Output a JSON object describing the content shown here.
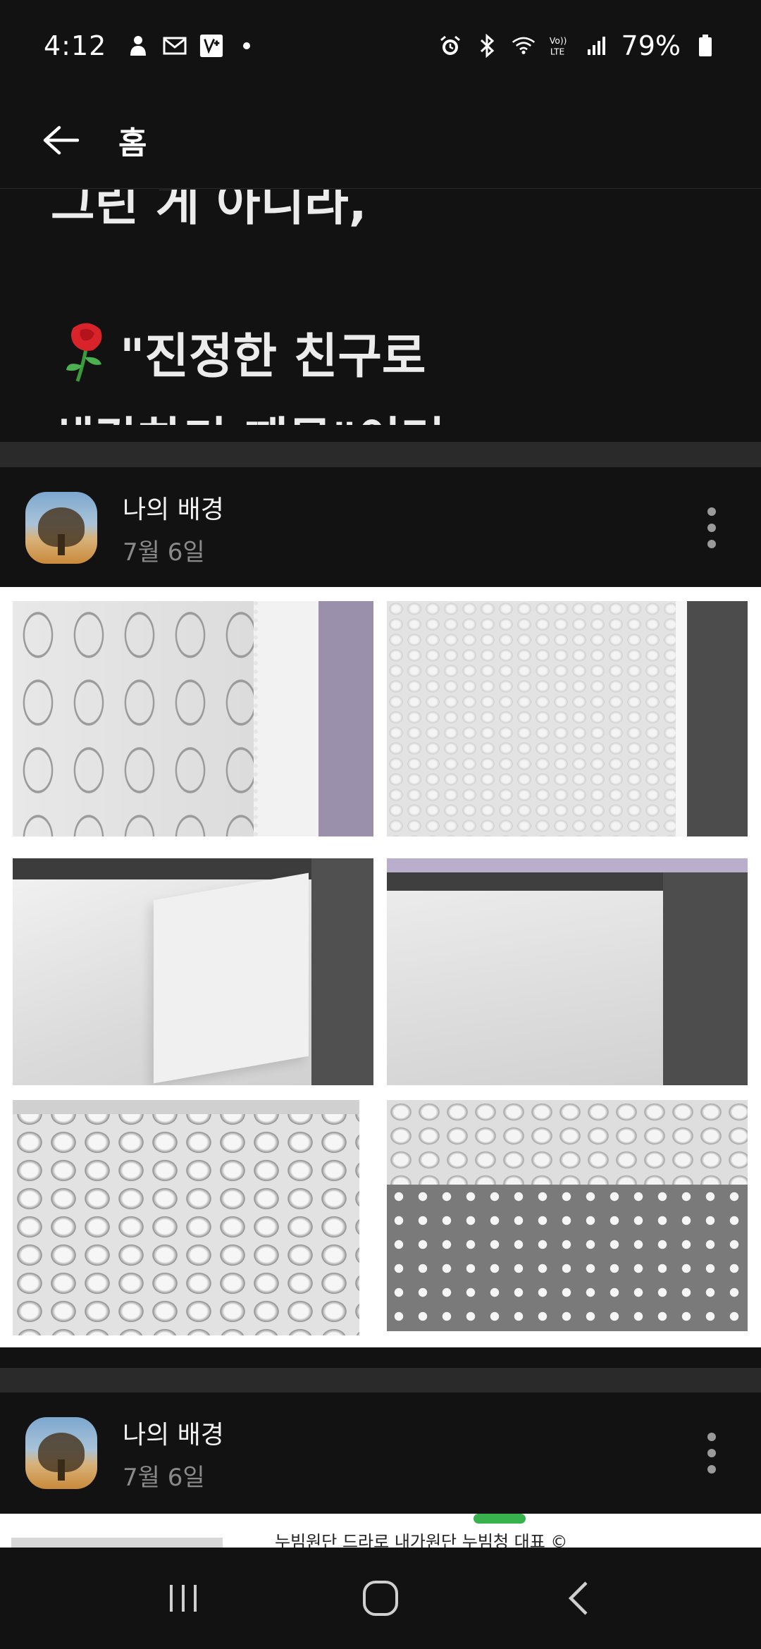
{
  "status_bar": {
    "time": "4:12",
    "battery": "79%",
    "left_icons": [
      "person-notification-icon",
      "mail-icon",
      "app-notification-icon"
    ],
    "right_icons": [
      "alarm-icon",
      "bluetooth-icon",
      "wifi-icon",
      "volte-icon",
      "signal-icon",
      "battery-icon"
    ]
  },
  "app_bar": {
    "title": "홈"
  },
  "post_text": {
    "line1": "그린 게 아니라,",
    "line2": "\"진정한 친구로",
    "line3": "생각하기 때문\"이며"
  },
  "posts": [
    {
      "author": "나의 배경",
      "date": "7월 6일",
      "photo_count": 6
    },
    {
      "author": "나의 배경",
      "date": "7월 6일",
      "preview_snippet": "누빔원단 드라로 내가원단 누빔청 대표 ©"
    }
  ],
  "colors": {
    "background": "#121212",
    "divider": "#2a2a2a",
    "text_primary": "#f2f2f2",
    "text_secondary": "#8a8a8a",
    "photo_panel": "#ffffff"
  }
}
